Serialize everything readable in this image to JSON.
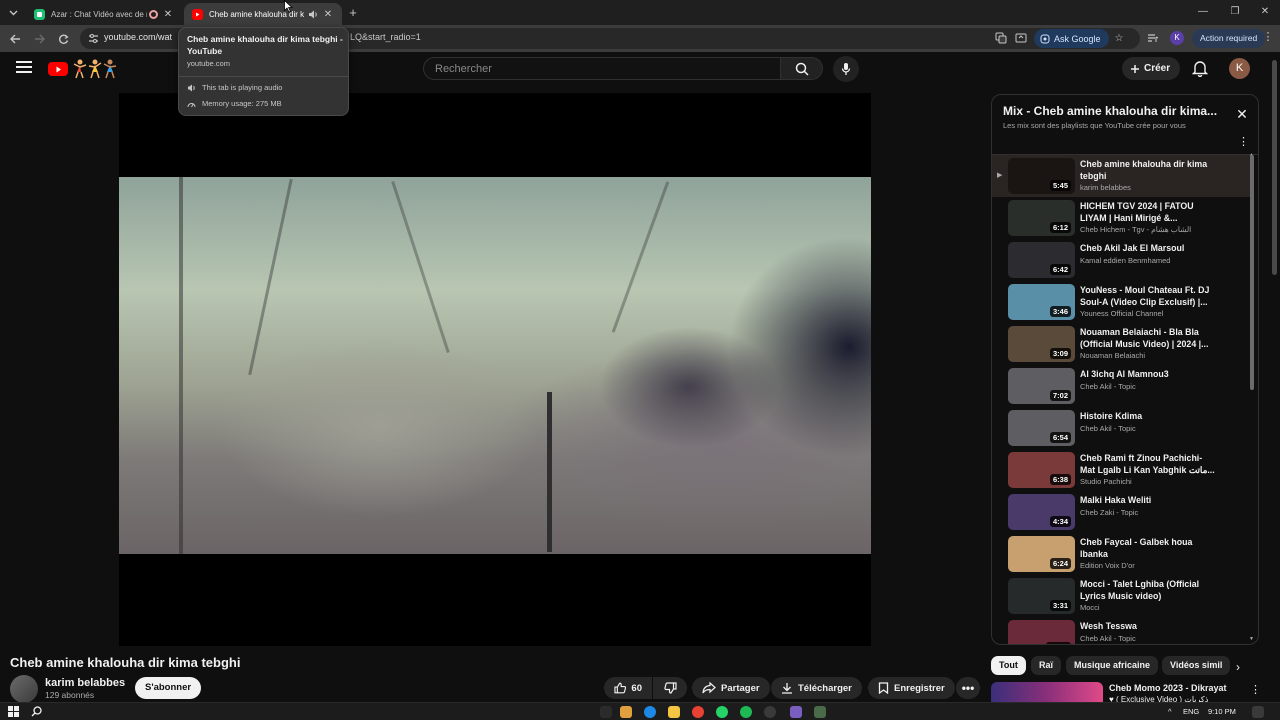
{
  "browser": {
    "tabs": [
      {
        "title": "Azar : Chat Vidéo avec de n",
        "active": false
      },
      {
        "title": "Cheb amine khalouha dir ki",
        "active": true
      }
    ],
    "address_url": "youtube.com/wat",
    "address_url_tail": "LQ&start_radio=1",
    "ask_google_label": "Ask Google",
    "profile_initial": "K",
    "action_required_label": "Action required",
    "tab_tooltip": {
      "title": "Cheb amine khalouha dir kima tebghi - YouTube",
      "domain": "youtube.com",
      "audio_status": "This tab is playing audio",
      "memory_usage": "Memory usage: 275 MB"
    }
  },
  "masthead": {
    "search_placeholder": "Rechercher",
    "create_label": "Créer",
    "avatar_initial": "K"
  },
  "video": {
    "title": "Cheb amine khalouha dir kima tebghi",
    "channel": "karim belabbes",
    "subscribers": "129 abonnés",
    "subscribe_label": "S'abonner",
    "likes": "60",
    "share_label": "Partager",
    "download_label": "Télécharger",
    "save_label": "Enregistrer"
  },
  "playlist": {
    "title": "Mix - Cheb amine khalouha dir kima...",
    "subtitle": "Les mix sont des playlists que YouTube crée pour vous",
    "items": [
      {
        "title": "Cheb amine khalouha dir kima tebghi",
        "channel": "karim belabbes",
        "duration": "5:45",
        "current": true,
        "thumb": "#1a1412"
      },
      {
        "title": "HICHEM TGV 2024 | FATOU LIYAM | Hani Mirigé &...",
        "channel": "Cheb Hichem - Tgv - الشاب هشام",
        "duration": "6:12",
        "current": false,
        "thumb": "#2a2e2a"
      },
      {
        "title": "Cheb Akil Jak El Marsoul",
        "channel": "Kamal eddien Benmhamed",
        "duration": "6:42",
        "current": false,
        "thumb": "#2b2b30"
      },
      {
        "title": "YouNess - Moul Chateau Ft. DJ Soul-A (Video Clip Exclusif) |...",
        "channel": "Youness Official Channel",
        "duration": "3:46",
        "current": false,
        "thumb": "#5a8fa8"
      },
      {
        "title": "Nouaman Belaiachi - Bla Bla (Official Music Video) | 2024 |...",
        "channel": "Nouaman Belaiachi",
        "duration": "3:09",
        "current": false,
        "thumb": "#5a4a3a"
      },
      {
        "title": "Al 3ichq Al Mamnou3",
        "channel": "Cheb Akil - Topic",
        "duration": "7:02",
        "current": false,
        "thumb": "#5d5d62"
      },
      {
        "title": "Histoire Kdima",
        "channel": "Cheb Akil - Topic",
        "duration": "6:54",
        "current": false,
        "thumb": "#5d5d62"
      },
      {
        "title": "Cheb Rami ft Zinou Pachichi- Mat Lgalb Li Kan Yabghik ماتت...",
        "channel": "Studio Pachichi",
        "duration": "6:38",
        "current": false,
        "thumb": "#7a3a3a"
      },
      {
        "title": "Malki Haka Weliti",
        "channel": "Cheb Zaki - Topic",
        "duration": "4:34",
        "current": false,
        "thumb": "#4a3a6a"
      },
      {
        "title": "Cheb Faycal - Galbek houa lbanka",
        "channel": "Edition Voix D'or",
        "duration": "6:24",
        "current": false,
        "thumb": "#c8a070"
      },
      {
        "title": "Mocci - Talet Lghiba (Official Lyrics Music video)",
        "channel": "Mocci",
        "duration": "3:31",
        "current": false,
        "thumb": "#262a2a"
      },
      {
        "title": "Wesh Tesswa",
        "channel": "Cheb Akil - Topic",
        "duration": "10:00",
        "current": false,
        "thumb": "#6a2a3a"
      }
    ]
  },
  "chips": [
    "Tout",
    "Raï",
    "Musique africaine",
    "Vidéos simil"
  ],
  "recommendation": {
    "title": "Cheb Momo 2023 - Dikrayat",
    "subtitle": "♥ ( Exclusive Video ) ذكريات"
  },
  "taskbar": {
    "language": "ENG",
    "time": "9:10 PM"
  }
}
